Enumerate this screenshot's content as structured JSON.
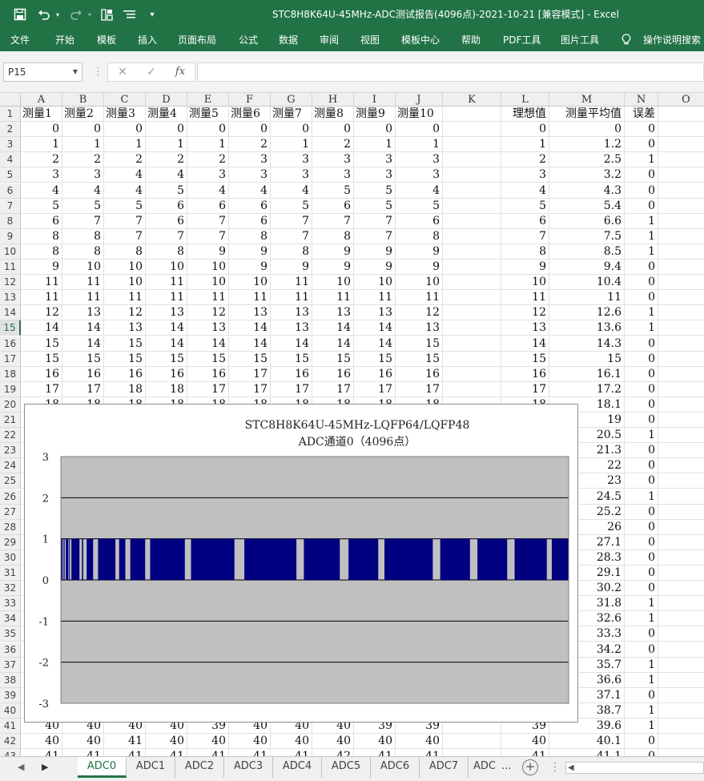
{
  "window": {
    "title": "STC8H8K64U-45MHz-ADC测试报告(4096点)-2021-10-21  [兼容模式]  -  Excel"
  },
  "qat": {
    "save_icon": "save-icon",
    "undo_icon": "undo-icon",
    "redo_icon": "redo-icon",
    "layout_icon": "layout-icon",
    "list_icon": "list-icon",
    "customize_icon": "customize-icon"
  },
  "ribbon": {
    "tabs": [
      "文件",
      "开始",
      "模板",
      "插入",
      "页面布局",
      "公式",
      "数据",
      "审阅",
      "视图",
      "模板中心",
      "帮助",
      "PDF工具",
      "图片工具"
    ],
    "tell_me": "操作说明搜索"
  },
  "formula_bar": {
    "name_box": "P15",
    "fx": "fx",
    "formula": ""
  },
  "sheet": {
    "columns": [
      "A",
      "B",
      "C",
      "D",
      "E",
      "F",
      "G",
      "H",
      "I",
      "J",
      "K",
      "L",
      "M",
      "N",
      "O"
    ],
    "row_numbers": [
      "1",
      "2",
      "3",
      "4",
      "5",
      "6",
      "7",
      "8",
      "9",
      "10",
      "11",
      "12",
      "13",
      "14",
      "15",
      "16",
      "17",
      "18",
      "19",
      "20",
      "21",
      "22",
      "23",
      "24",
      "25",
      "26",
      "27",
      "28",
      "29",
      "30",
      "31",
      "32",
      "33",
      "34",
      "35",
      "36",
      "37",
      "38",
      "39",
      "40",
      "41",
      "42",
      "43"
    ],
    "selected_row": "15",
    "header_row": [
      "测量1",
      "测量2",
      "测量3",
      "测量4",
      "测量5",
      "测量6",
      "测量7",
      "测量8",
      "测量9",
      "测量10",
      "",
      "理想值",
      "测量平均值",
      "误差"
    ],
    "rows": [
      [
        "0",
        "0",
        "0",
        "0",
        "0",
        "0",
        "0",
        "0",
        "0",
        "0",
        "",
        "0",
        "0",
        "0"
      ],
      [
        "1",
        "1",
        "1",
        "1",
        "1",
        "2",
        "1",
        "2",
        "1",
        "1",
        "",
        "1",
        "1.2",
        "0"
      ],
      [
        "2",
        "2",
        "2",
        "2",
        "2",
        "3",
        "3",
        "3",
        "3",
        "3",
        "",
        "2",
        "2.5",
        "1"
      ],
      [
        "3",
        "3",
        "4",
        "4",
        "3",
        "3",
        "3",
        "3",
        "3",
        "3",
        "",
        "3",
        "3.2",
        "0"
      ],
      [
        "4",
        "4",
        "4",
        "5",
        "4",
        "4",
        "4",
        "5",
        "5",
        "4",
        "",
        "4",
        "4.3",
        "0"
      ],
      [
        "5",
        "5",
        "5",
        "6",
        "6",
        "6",
        "5",
        "6",
        "5",
        "5",
        "",
        "5",
        "5.4",
        "0"
      ],
      [
        "6",
        "7",
        "7",
        "6",
        "7",
        "6",
        "7",
        "7",
        "7",
        "6",
        "",
        "6",
        "6.6",
        "1"
      ],
      [
        "8",
        "8",
        "7",
        "7",
        "7",
        "8",
        "7",
        "8",
        "7",
        "8",
        "",
        "7",
        "7.5",
        "1"
      ],
      [
        "8",
        "8",
        "8",
        "8",
        "9",
        "9",
        "8",
        "9",
        "9",
        "9",
        "",
        "8",
        "8.5",
        "1"
      ],
      [
        "9",
        "10",
        "10",
        "10",
        "10",
        "9",
        "9",
        "9",
        "9",
        "9",
        "",
        "9",
        "9.4",
        "0"
      ],
      [
        "11",
        "11",
        "10",
        "11",
        "10",
        "10",
        "11",
        "10",
        "10",
        "10",
        "",
        "10",
        "10.4",
        "0"
      ],
      [
        "11",
        "11",
        "11",
        "11",
        "11",
        "11",
        "11",
        "11",
        "11",
        "11",
        "",
        "11",
        "11",
        "0"
      ],
      [
        "12",
        "13",
        "12",
        "13",
        "12",
        "13",
        "13",
        "13",
        "13",
        "12",
        "",
        "12",
        "12.6",
        "1"
      ],
      [
        "14",
        "14",
        "13",
        "14",
        "13",
        "14",
        "13",
        "14",
        "14",
        "13",
        "",
        "13",
        "13.6",
        "1"
      ],
      [
        "15",
        "14",
        "15",
        "14",
        "14",
        "14",
        "14",
        "14",
        "14",
        "15",
        "",
        "14",
        "14.3",
        "0"
      ],
      [
        "15",
        "15",
        "15",
        "15",
        "15",
        "15",
        "15",
        "15",
        "15",
        "15",
        "",
        "15",
        "15",
        "0"
      ],
      [
        "16",
        "16",
        "16",
        "16",
        "16",
        "17",
        "16",
        "16",
        "16",
        "16",
        "",
        "16",
        "16.1",
        "0"
      ],
      [
        "17",
        "17",
        "18",
        "18",
        "17",
        "17",
        "17",
        "17",
        "17",
        "17",
        "",
        "17",
        "17.2",
        "0"
      ],
      [
        "18",
        "18",
        "18",
        "18",
        "18",
        "18",
        "18",
        "18",
        "18",
        "18",
        "",
        "18",
        "18.1",
        "0"
      ],
      [
        "",
        "",
        "",
        "",
        "",
        "",
        "",
        "",
        "",
        "",
        "",
        "",
        "19",
        "0"
      ],
      [
        "",
        "",
        "",
        "",
        "",
        "",
        "",
        "",
        "",
        "",
        "",
        "",
        "20.5",
        "1"
      ],
      [
        "",
        "",
        "",
        "",
        "",
        "",
        "",
        "",
        "",
        "",
        "",
        "",
        "21.3",
        "0"
      ],
      [
        "",
        "",
        "",
        "",
        "",
        "",
        "",
        "",
        "",
        "",
        "",
        "",
        "22",
        "0"
      ],
      [
        "",
        "",
        "",
        "",
        "",
        "",
        "",
        "",
        "",
        "",
        "",
        "",
        "23",
        "0"
      ],
      [
        "",
        "",
        "",
        "",
        "",
        "",
        "",
        "",
        "",
        "",
        "",
        "",
        "24.5",
        "1"
      ],
      [
        "",
        "",
        "",
        "",
        "",
        "",
        "",
        "",
        "",
        "",
        "",
        "",
        "25.2",
        "0"
      ],
      [
        "",
        "",
        "",
        "",
        "",
        "",
        "",
        "",
        "",
        "",
        "",
        "",
        "26",
        "0"
      ],
      [
        "",
        "",
        "",
        "",
        "",
        "",
        "",
        "",
        "",
        "",
        "",
        "",
        "27.1",
        "0"
      ],
      [
        "",
        "",
        "",
        "",
        "",
        "",
        "",
        "",
        "",
        "",
        "",
        "",
        "28.3",
        "0"
      ],
      [
        "",
        "",
        "",
        "",
        "",
        "",
        "",
        "",
        "",
        "",
        "",
        "",
        "29.1",
        "0"
      ],
      [
        "",
        "",
        "",
        "",
        "",
        "",
        "",
        "",
        "",
        "",
        "",
        "",
        "30.2",
        "0"
      ],
      [
        "",
        "",
        "",
        "",
        "",
        "",
        "",
        "",
        "",
        "",
        "",
        "",
        "31.8",
        "1"
      ],
      [
        "",
        "",
        "",
        "",
        "",
        "",
        "",
        "",
        "",
        "",
        "",
        "",
        "32.6",
        "1"
      ],
      [
        "",
        "",
        "",
        "",
        "",
        "",
        "",
        "",
        "",
        "",
        "",
        "",
        "33.3",
        "0"
      ],
      [
        "",
        "",
        "",
        "",
        "",
        "",
        "",
        "",
        "",
        "",
        "",
        "",
        "34.2",
        "0"
      ],
      [
        "",
        "",
        "",
        "",
        "",
        "",
        "",
        "",
        "",
        "",
        "",
        "",
        "35.7",
        "1"
      ],
      [
        "",
        "",
        "",
        "",
        "",
        "",
        "",
        "",
        "",
        "",
        "",
        "",
        "36.6",
        "1"
      ],
      [
        "",
        "",
        "",
        "",
        "",
        "",
        "",
        "",
        "",
        "",
        "",
        "",
        "37.1",
        "0"
      ],
      [
        "",
        "",
        "",
        "",
        "",
        "",
        "",
        "",
        "",
        "",
        "",
        "",
        "38.7",
        "1"
      ],
      [
        "40",
        "40",
        "40",
        "40",
        "39",
        "40",
        "40",
        "40",
        "39",
        "39",
        "",
        "39",
        "39.6",
        "1"
      ],
      [
        "40",
        "40",
        "41",
        "40",
        "40",
        "40",
        "40",
        "40",
        "40",
        "40",
        "",
        "40",
        "40.1",
        "0"
      ],
      [
        "41",
        "41",
        "41",
        "41",
        "41",
        "41",
        "41",
        "42",
        "41",
        "41",
        "",
        "41",
        "41.1",
        "0"
      ]
    ]
  },
  "chart_data": {
    "type": "bar",
    "title": "STC8H8K64U-45MHz-LQFP64/LQFP48",
    "subtitle": "ADC通道0（4096点）",
    "ylim": [
      -3,
      3
    ],
    "yticks": [
      "3",
      "2",
      "1",
      "0",
      "-1",
      "-2",
      "-3"
    ],
    "n_points": 4096,
    "series": [
      {
        "color": "#000080",
        "values_description_ranges": [
          [
            0,
            14
          ],
          [
            22,
            30
          ],
          [
            40,
            60
          ],
          [
            66,
            70
          ],
          [
            85,
            150
          ],
          [
            170,
            180
          ],
          [
            208,
            260
          ],
          [
            300,
            440
          ],
          [
            470,
            520
          ],
          [
            560,
            680
          ],
          [
            720,
            1000
          ],
          [
            1050,
            1400
          ],
          [
            1480,
            1900
          ],
          [
            1960,
            2250
          ],
          [
            2320,
            2560
          ],
          [
            2610,
            3000
          ],
          [
            3060,
            3300
          ],
          [
            3360,
            3600
          ],
          [
            3660,
            3920
          ],
          [
            3960,
            4095
          ]
        ]
      }
    ],
    "plot_bg": "#c0c0c0",
    "grid": true
  },
  "sheet_tabs": {
    "tabs": [
      "ADC0",
      "ADC1",
      "ADC2",
      "ADC3",
      "ADC4",
      "ADC5",
      "ADC6",
      "ADC7",
      "ADC"
    ],
    "active": "ADC0",
    "more": "..."
  }
}
